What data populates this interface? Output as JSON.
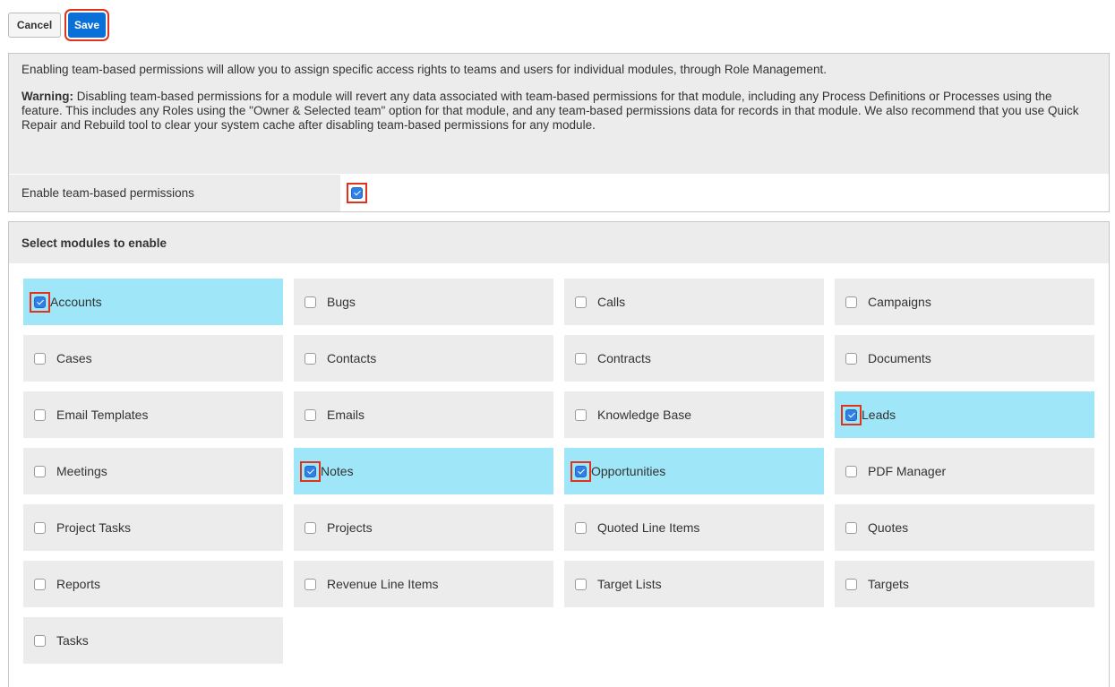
{
  "toolbar": {
    "cancel_label": "Cancel",
    "save_label": "Save"
  },
  "info": {
    "intro": "Enabling team-based permissions will allow you to assign specific access rights to teams and users for individual modules, through Role Management.",
    "warning_label": "Warning:",
    "warning_text": " Disabling team-based permissions for a module will revert any data associated with team-based permissions for that module, including any Process Definitions or Processes using the feature. This includes any Roles using the \"Owner & Selected team\" option for that module, and any team-based permissions data for records in that module. We also recommend that you use Quick Repair and Rebuild tool to clear your system cache after disabling team-based permissions for any module.",
    "enable_label": "Enable team-based permissions",
    "enable_checked": true
  },
  "modules": {
    "header": "Select modules to enable",
    "items": [
      {
        "label": "Accounts",
        "checked": true
      },
      {
        "label": "Bugs",
        "checked": false
      },
      {
        "label": "Calls",
        "checked": false
      },
      {
        "label": "Campaigns",
        "checked": false
      },
      {
        "label": "Cases",
        "checked": false
      },
      {
        "label": "Contacts",
        "checked": false
      },
      {
        "label": "Contracts",
        "checked": false
      },
      {
        "label": "Documents",
        "checked": false
      },
      {
        "label": "Email Templates",
        "checked": false
      },
      {
        "label": "Emails",
        "checked": false
      },
      {
        "label": "Knowledge Base",
        "checked": false
      },
      {
        "label": "Leads",
        "checked": true
      },
      {
        "label": "Meetings",
        "checked": false
      },
      {
        "label": "Notes",
        "checked": true
      },
      {
        "label": "Opportunities",
        "checked": true
      },
      {
        "label": "PDF Manager",
        "checked": false
      },
      {
        "label": "Project Tasks",
        "checked": false
      },
      {
        "label": "Projects",
        "checked": false
      },
      {
        "label": "Quoted Line Items",
        "checked": false
      },
      {
        "label": "Quotes",
        "checked": false
      },
      {
        "label": "Reports",
        "checked": false
      },
      {
        "label": "Revenue Line Items",
        "checked": false
      },
      {
        "label": "Target Lists",
        "checked": false
      },
      {
        "label": "Targets",
        "checked": false
      },
      {
        "label": "Tasks",
        "checked": false
      }
    ]
  },
  "colors": {
    "save": "#0a6fd6",
    "checked_tile": "#9ee6f8",
    "tile": "#ececec",
    "highlight": "#e0321c"
  }
}
